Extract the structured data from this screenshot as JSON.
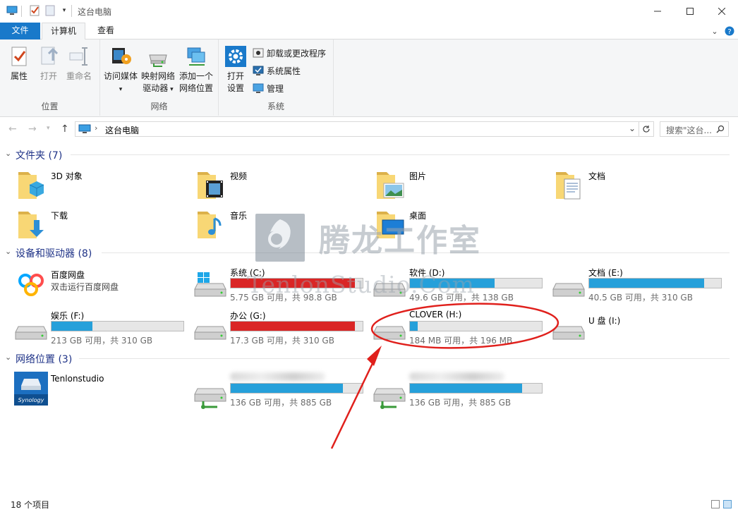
{
  "window": {
    "title": "这台电脑",
    "minimize": "—",
    "maximize": "☐",
    "close": "✕"
  },
  "ribbon_tabs": {
    "file": "文件",
    "computer": "计算机",
    "view": "查看"
  },
  "ribbon": {
    "location": {
      "label": "位置",
      "properties": "属性",
      "open": "打开",
      "rename": "重命名"
    },
    "network": {
      "label": "网络",
      "media_line1": "访问媒体",
      "map_line1": "映射网络",
      "map_line2": "驱动器",
      "add_line1": "添加一个",
      "add_line2": "网络位置"
    },
    "system": {
      "label": "系统",
      "settings_line1": "打开",
      "settings_line2": "设置",
      "uninstall": "卸载或更改程序",
      "sysprops": "系统属性",
      "manage": "管理"
    }
  },
  "address": {
    "path": "这台电脑",
    "search_placeholder": "搜索\"这台...",
    "refresh_icon": "refresh-icon"
  },
  "sections": {
    "folders": "文件夹 (7)",
    "devices": "设备和驱动器 (8)",
    "network": "网络位置 (3)"
  },
  "folders": [
    {
      "name": "3D 对象",
      "icon": "3d-objects-folder-icon"
    },
    {
      "name": "视频",
      "icon": "videos-folder-icon"
    },
    {
      "name": "图片",
      "icon": "pictures-folder-icon"
    },
    {
      "name": "文档",
      "icon": "documents-folder-icon"
    },
    {
      "name": "下载",
      "icon": "downloads-folder-icon"
    },
    {
      "name": "音乐",
      "icon": "music-folder-icon"
    },
    {
      "name": "桌面",
      "icon": "desktop-folder-icon"
    }
  ],
  "devices": [
    {
      "name": "百度网盘",
      "info": "双击运行百度网盘",
      "type": "app"
    },
    {
      "name": "系统 (C:)",
      "info": "5.75 GB 可用，共 98.8 GB",
      "used_fraction": 0.94,
      "warn": true
    },
    {
      "name": "软件 (D:)",
      "info": "49.6 GB 可用，共 138 GB",
      "used_fraction": 0.64,
      "warn": false
    },
    {
      "name": "文档 (E:)",
      "info": "40.5 GB 可用，共 310 GB",
      "used_fraction": 0.87,
      "warn": false
    },
    {
      "name": "娱乐 (F:)",
      "info": "213 GB 可用，共 310 GB",
      "used_fraction": 0.31,
      "warn": false
    },
    {
      "name": "办公 (G:)",
      "info": "17.3 GB 可用，共 310 GB",
      "used_fraction": 0.94,
      "warn": true
    },
    {
      "name": "CLOVER (H:)",
      "info": "184 MB 可用，共 196 MB",
      "used_fraction": 0.06,
      "warn": false
    },
    {
      "name": "U 盘 (I:)",
      "info": "",
      "type": "usb"
    }
  ],
  "network_locations": [
    {
      "name": "Tenlonstudio",
      "info": "",
      "type": "media-server"
    },
    {
      "name": "",
      "info": "136 GB 可用，共 885 GB",
      "used_fraction": 0.85
    },
    {
      "name": "",
      "info": "136 GB 可用，共 885 GB",
      "used_fraction": 0.85
    }
  ],
  "status": {
    "count": "18 个项目"
  },
  "watermark": {
    "title": "腾龙工作室",
    "subtitle": "TenlonStudio.Com"
  },
  "colors": {
    "accent": "#1979ca",
    "bar_normal": "#26a0da",
    "bar_warn": "#da2626",
    "section_title": "#1e3287",
    "annotation": "#e0201c"
  }
}
